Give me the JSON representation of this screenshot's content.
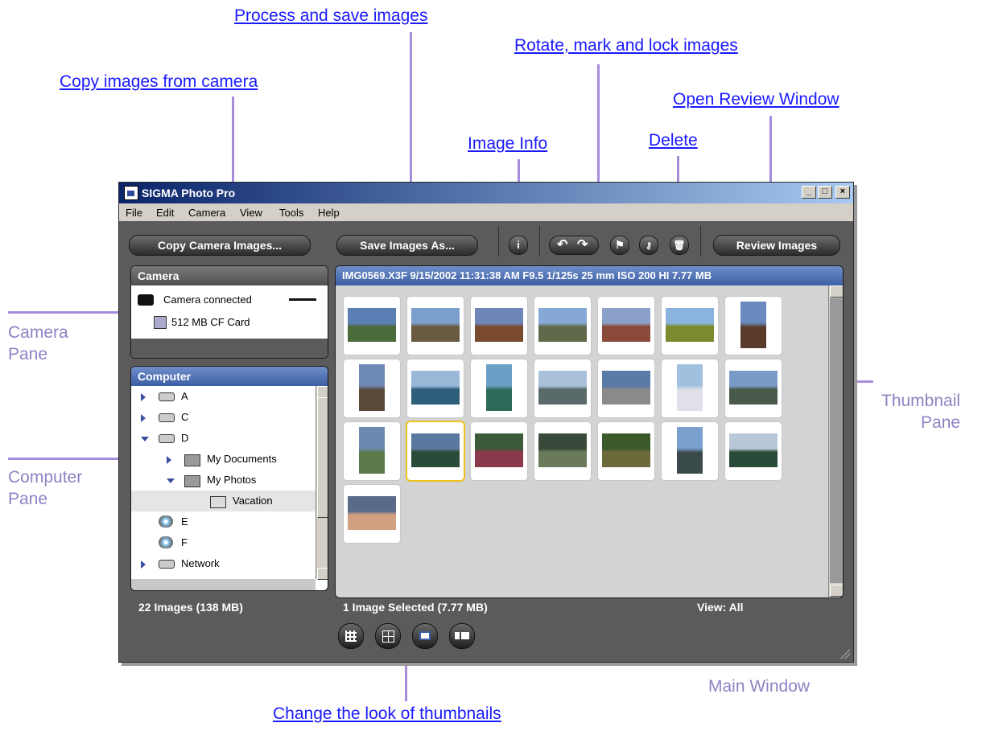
{
  "callouts": {
    "process": "Process and save images",
    "rotate": "Rotate, mark and lock images",
    "copy": "Copy images from camera",
    "review": "Open Review Window",
    "info": "Image Info",
    "delete": "Delete",
    "looks": "Change the look of thumbnails"
  },
  "side_labels": {
    "camera_pane_1": "Camera",
    "camera_pane_2": "Pane",
    "computer_pane_1": "Computer",
    "computer_pane_2": "Pane",
    "thumbnail_pane_1": "Thumbnail",
    "thumbnail_pane_2": "Pane",
    "main_window": "Main Window"
  },
  "window": {
    "title": "SIGMA Photo Pro",
    "controls": {
      "minimize": "_",
      "maximize": "□",
      "close": "×"
    }
  },
  "menu": {
    "items": [
      "File",
      "Edit",
      "Camera",
      "View",
      "Tools",
      "Help"
    ]
  },
  "toolbar": {
    "copy_label": "Copy Camera Images...",
    "save_label": "Save Images As...",
    "info_glyph": "i",
    "review_label": "Review Images"
  },
  "camera_pane": {
    "title": "Camera",
    "status": "Camera connected",
    "card": "512 MB  CF Card"
  },
  "computer_pane": {
    "title": "Computer",
    "items": [
      {
        "label": "A",
        "expander": "collapsed",
        "icon": "floppy-drive-icon"
      },
      {
        "label": "C",
        "expander": "collapsed",
        "icon": "hard-drive-icon"
      },
      {
        "label": "D",
        "expander": "expanded",
        "icon": "hard-drive-icon"
      },
      {
        "label": "My Documents",
        "expander": "collapsed",
        "icon": "folder-icon"
      },
      {
        "label": "My Photos",
        "expander": "expanded",
        "icon": "folder-icon"
      },
      {
        "label": "Vacation",
        "expander": "none",
        "icon": "open-folder-icon",
        "selected": true
      },
      {
        "label": "E",
        "expander": "none",
        "icon": "cd-drive-icon"
      },
      {
        "label": "F",
        "expander": "none",
        "icon": "cd-drive-icon"
      },
      {
        "label": "Network",
        "expander": "collapsed",
        "icon": "network-drive-icon"
      }
    ],
    "status": "22 Images   (138 MB)"
  },
  "thumbnail_pane": {
    "info_bar": "IMG0569.X3F  9/15/2002  11:31:38 AM  F9.5  1/125s  25 mm  ISO 200  HI  7.77 MB",
    "status_selected": "1  Image Selected  (7.77 MB)",
    "status_view": "View: All",
    "thumb_count": 22,
    "selected_index": 15
  },
  "colors": {
    "accent_callout": "#1a1aff",
    "arrow": "#a68ddc",
    "side_label": "#8a84c4",
    "window_bg": "#5b5b5b",
    "pane_head_blue": "#3c5fa5",
    "selection": "#f0c020"
  }
}
